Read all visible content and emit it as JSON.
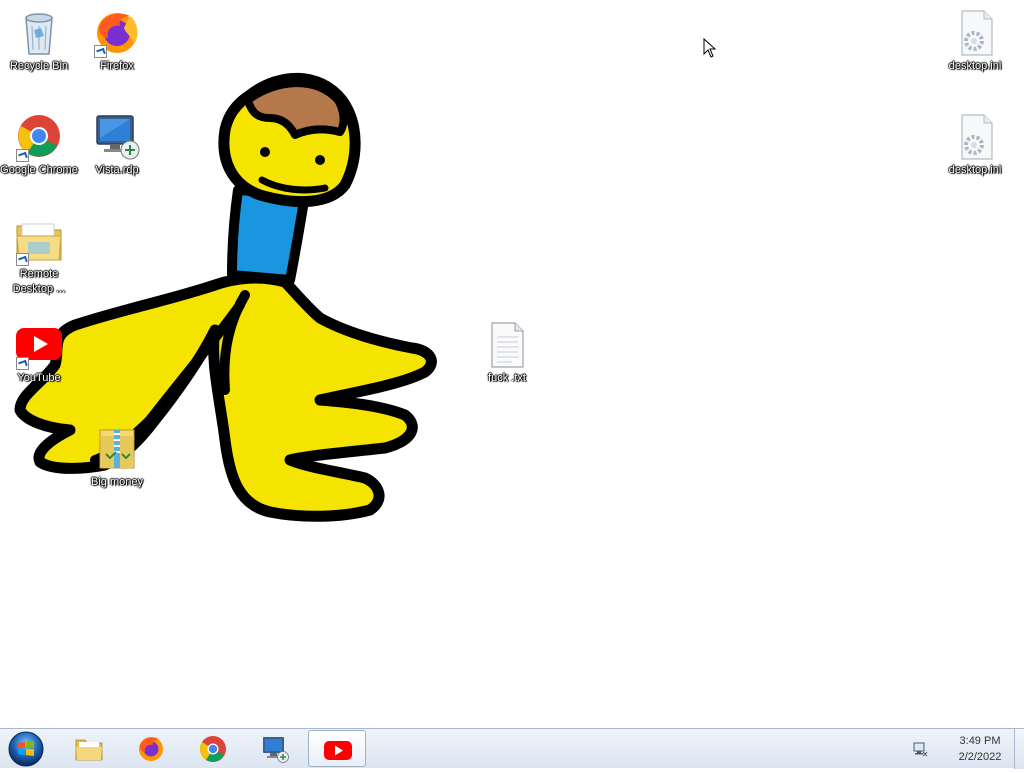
{
  "desktop": {
    "icons": {
      "recycle_bin": {
        "label": "Recycle Bin",
        "icon": "recycle-bin-icon"
      },
      "firefox": {
        "label": "Firefox",
        "icon": "firefox-icon"
      },
      "chrome": {
        "label": "Google Chrome",
        "icon": "chrome-icon"
      },
      "vistardp": {
        "label": "Vista.rdp",
        "icon": "remote-desktop-monitor-icon"
      },
      "remote_desktop": {
        "label": "Remote Desktop ...",
        "icon": "folder-icon"
      },
      "youtube": {
        "label": "YouTube",
        "icon": "youtube-icon"
      },
      "big_money": {
        "label": "Big money",
        "icon": "zip-folder-icon"
      },
      "fuck_txt": {
        "label": "fuck .txt",
        "icon": "text-file-icon"
      },
      "desktop_ini_1": {
        "label": "desktop.ini",
        "icon": "settings-file-icon"
      },
      "desktop_ini_2": {
        "label": "desktop.ini",
        "icon": "settings-file-icon"
      }
    },
    "wallpaper": "hand-drawn-yellow-figure",
    "colors": {
      "figure_yellow": "#f5e400",
      "figure_outline": "#000000",
      "hair_brown": "#b5784a",
      "neck_blue": "#1a96e0"
    }
  },
  "taskbar": {
    "start": "windows-start-orb",
    "pinned": [
      {
        "name": "file-explorer",
        "icon": "folder-icon"
      },
      {
        "name": "firefox",
        "icon": "firefox-icon"
      },
      {
        "name": "chrome",
        "icon": "chrome-icon"
      },
      {
        "name": "remote-desktop",
        "icon": "remote-desktop-monitor-icon"
      },
      {
        "name": "youtube",
        "icon": "youtube-icon",
        "active": true
      }
    ],
    "clock": {
      "time": "3:49 PM",
      "date": "2/2/2022"
    }
  }
}
